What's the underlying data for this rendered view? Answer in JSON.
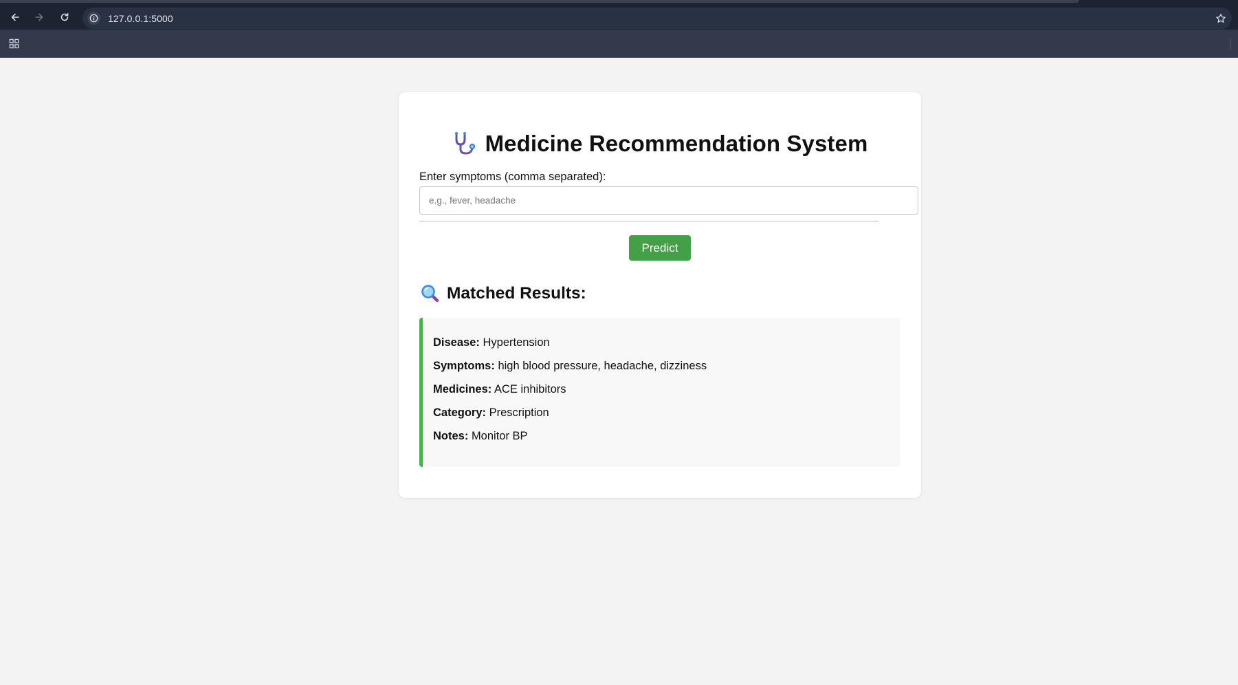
{
  "browser": {
    "url": "127.0.0.1:5000",
    "icons": [
      "back-icon",
      "forward-icon",
      "reload-icon",
      "info-icon",
      "star-icon",
      "apps-icon"
    ]
  },
  "page": {
    "title": "Medicine Recommendation System",
    "title_icon": "stethoscope-icon",
    "input_label": "Enter symptoms (comma separated):",
    "input_placeholder": "e.g., fever, headache",
    "input_value": "",
    "predict_label": "Predict",
    "results_icon": "magnifying-glass-icon",
    "results_title": "Matched Results:",
    "result": {
      "disease_label": "Disease:",
      "disease": "Hypertension",
      "symptoms_label": "Symptoms:",
      "symptoms": "high blood pressure, headache, dizziness",
      "medicines_label": "Medicines:",
      "medicines": "ACE inhibitors",
      "category_label": "Category:",
      "category": "Prescription",
      "notes_label": "Notes:",
      "notes": "Monitor BP"
    }
  },
  "colors": {
    "page_background": "#f3f3f3",
    "card_background": "#ffffff",
    "predict_button": "#43a047",
    "result_accent": "#4caf50",
    "result_background": "#f8f8f8",
    "browser_toolbar": "#1c2331",
    "browser_bookmarks_bar": "#333a4b"
  }
}
